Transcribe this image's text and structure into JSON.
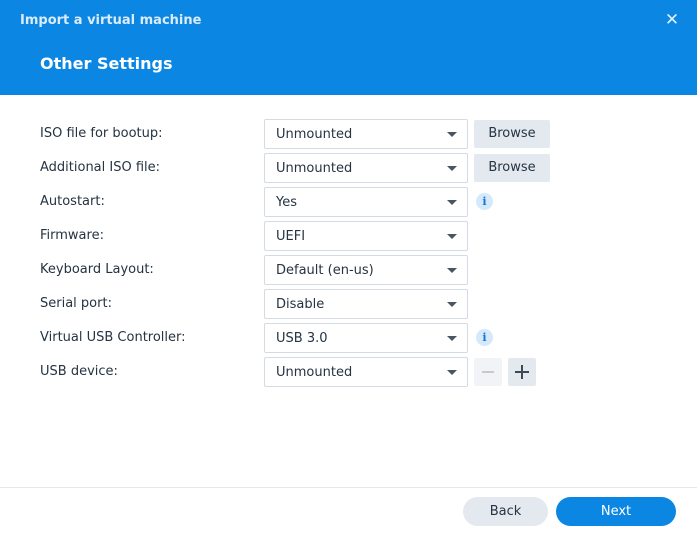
{
  "window": {
    "title": "Import a virtual machine",
    "close_icon": "close-icon"
  },
  "header": {
    "page_title": "Other Settings",
    "background_color": "#0b87e3"
  },
  "form": {
    "rows": [
      {
        "label": "ISO file for bootup:",
        "value": "Unmounted",
        "action": "Browse"
      },
      {
        "label": "Additional ISO file:",
        "value": "Unmounted",
        "action": "Browse"
      },
      {
        "label": "Autostart:",
        "value": "Yes",
        "info_icon": "info-icon"
      },
      {
        "label": "Firmware:",
        "value": "UEFI"
      },
      {
        "label": "Keyboard Layout:",
        "value": "Default (en-us)"
      },
      {
        "label": "Serial port:",
        "value": "Disable"
      },
      {
        "label": "Virtual USB Controller:",
        "value": "USB 3.0",
        "info_icon": "info-icon"
      },
      {
        "label": "USB device:",
        "value": "Unmounted",
        "buttons": [
          "minus-icon",
          "plus-icon"
        ]
      }
    ]
  },
  "footer": {
    "back_label": "Back",
    "next_label": "Next",
    "accent_color": "#0b87e3"
  }
}
